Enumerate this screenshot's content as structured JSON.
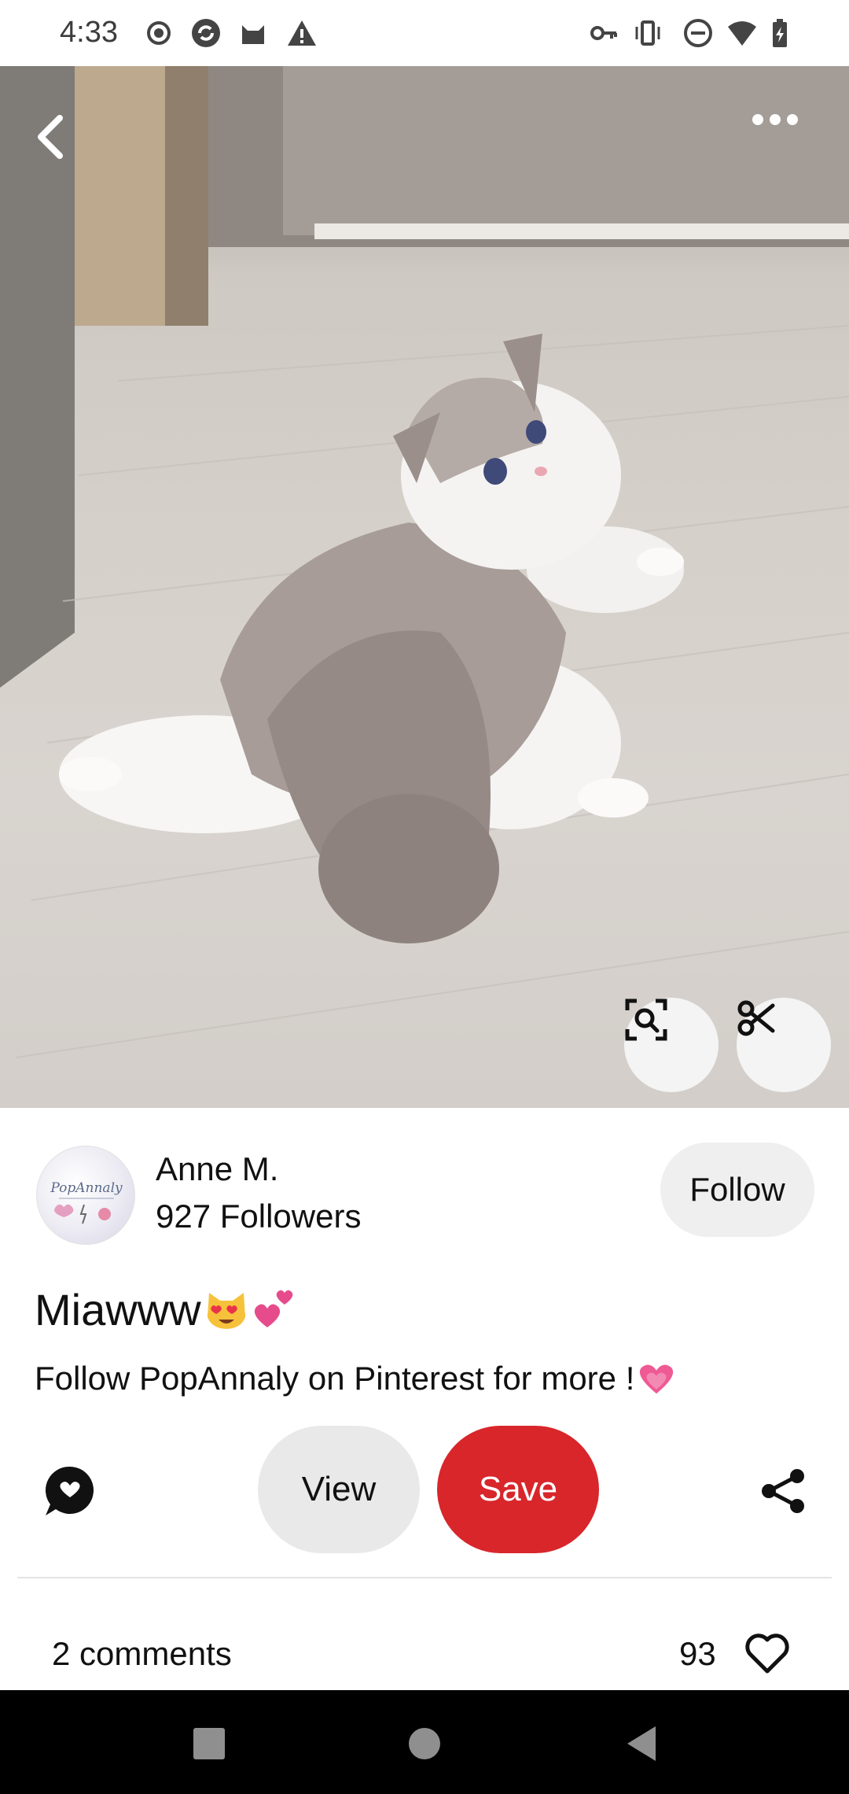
{
  "status_bar": {
    "time": "4:33",
    "left_icons": [
      "record-icon",
      "sync-icon",
      "cat-icon",
      "warning-icon"
    ],
    "right_icons": [
      "key-icon",
      "vibrate-icon",
      "dnd-icon",
      "wifi-icon",
      "battery-icon"
    ]
  },
  "pin_image": {
    "icons": [
      "back-icon",
      "more-icon",
      "visual-search-icon",
      "scissors-icon"
    ]
  },
  "creator": {
    "avatar_text": "PopAnnaly",
    "name": "Anne M.",
    "followers": "927 Followers",
    "follow_label": "Follow"
  },
  "pin": {
    "title": "Miawww",
    "title_emojis": [
      "heart-eyes-cat-emoji",
      "two-hearts-emoji"
    ],
    "description": "Follow PopAnnaly on Pinterest for more !",
    "description_emoji": "growing-heart-emoji"
  },
  "actions": {
    "view_label": "View",
    "save_label": "Save",
    "save_color": "#d8262b"
  },
  "engagement": {
    "comments": "2 comments",
    "likes": "93"
  },
  "nav_bar": {
    "icons": [
      "recents-icon",
      "home-icon",
      "back-nav-icon"
    ]
  }
}
